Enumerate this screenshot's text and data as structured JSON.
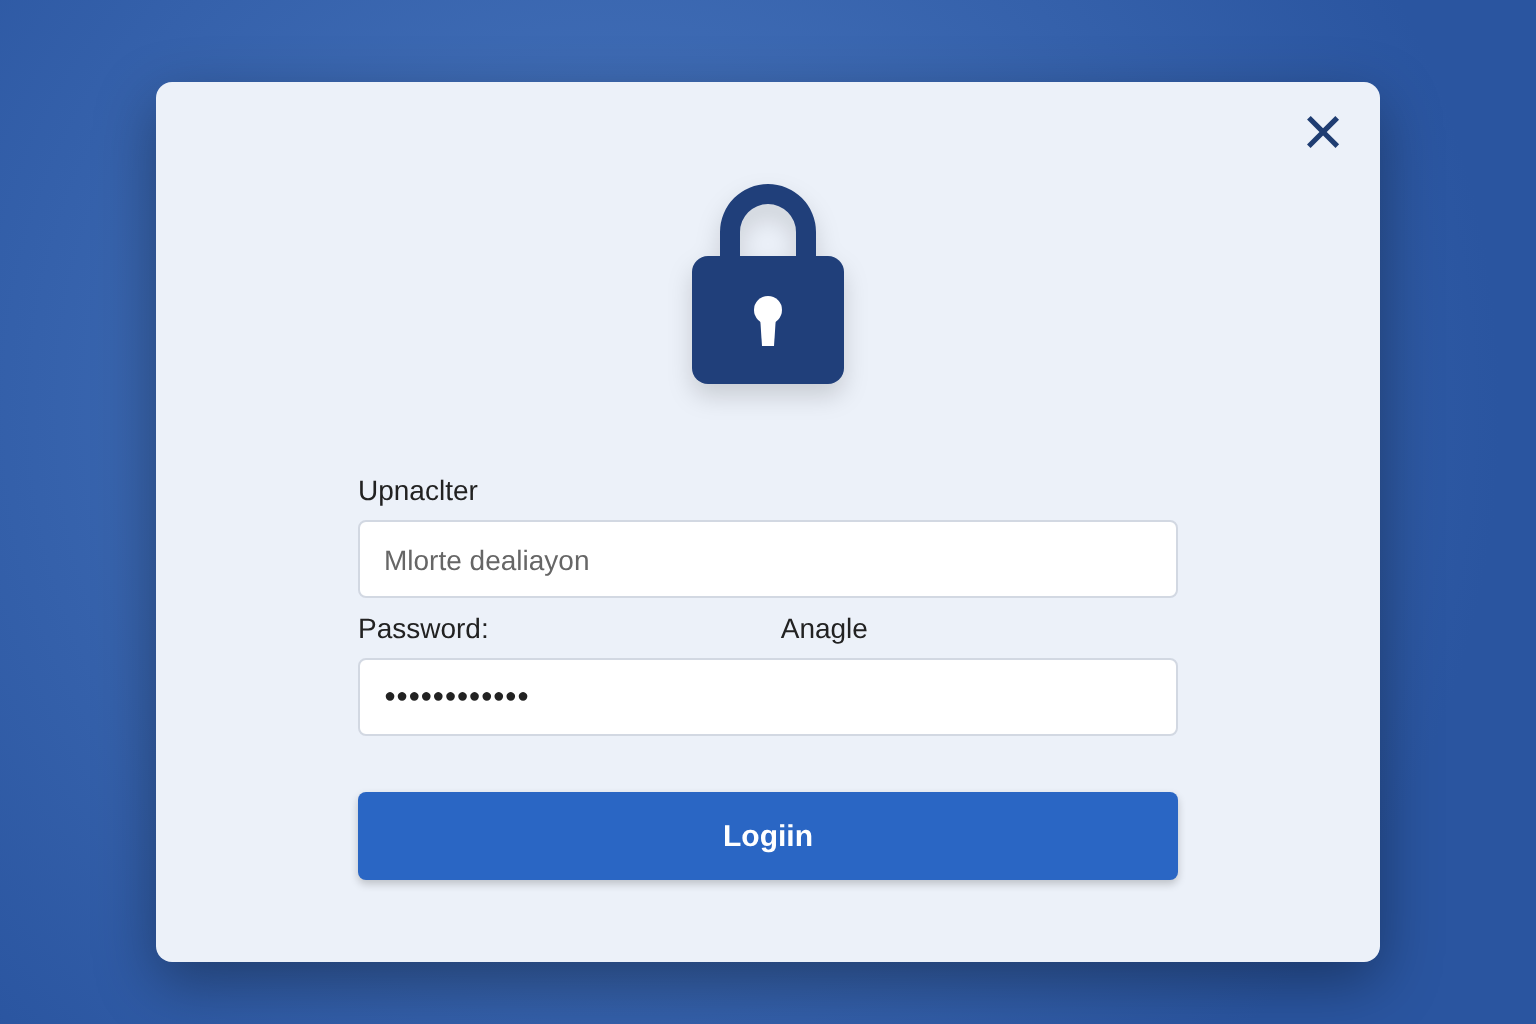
{
  "dialog": {
    "close": "×",
    "username": {
      "label": "Upnaclter",
      "placeholder": "Mlorte dealiayon"
    },
    "password": {
      "label": "Password:",
      "side_label": "Anagle",
      "value": "●●●●●●●●●●●●"
    },
    "button": "Logiin"
  }
}
